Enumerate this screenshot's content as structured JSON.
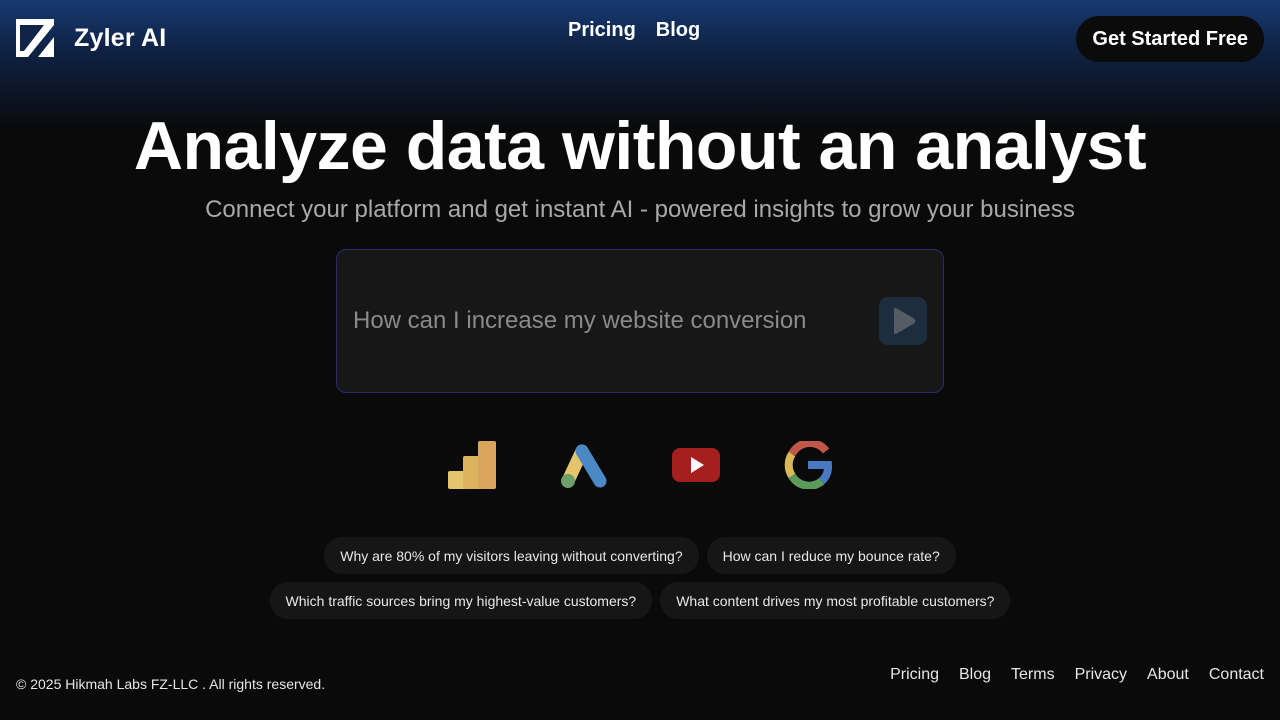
{
  "brand": {
    "name": "Zyler AI",
    "logo_icon": "zyler-z-logo-icon"
  },
  "nav": {
    "items": [
      {
        "label": "Pricing"
      },
      {
        "label": "Blog"
      }
    ]
  },
  "header": {
    "cta_label": "Get Started Free"
  },
  "hero": {
    "title": "Analyze data without an analyst",
    "subtitle": "Connect your platform and get instant AI - powered insights to grow your business"
  },
  "query": {
    "placeholder": "How can I increase my website conversion",
    "send_icon": "play-icon"
  },
  "integrations": [
    {
      "icon": "google-analytics-icon"
    },
    {
      "icon": "google-ads-icon"
    },
    {
      "icon": "youtube-icon"
    },
    {
      "icon": "google-icon"
    }
  ],
  "suggestions": {
    "row1": [
      "Why are 80% of my visitors leaving without converting?",
      "How can I reduce my bounce rate?"
    ],
    "row2": [
      "Which traffic sources bring my highest-value customers?",
      "What content drives my most profitable customers?"
    ]
  },
  "footer": {
    "copyright": "© 2025 Hikmah Labs FZ-LLC . All rights reserved.",
    "links": [
      "Pricing",
      "Blog",
      "Terms",
      "Privacy",
      "About",
      "Contact"
    ]
  },
  "colors": {
    "background": "#0a0a0a",
    "header_gradient_top": "#163a72",
    "query_border": "#2b2a72",
    "chip_bg": "#161616"
  }
}
